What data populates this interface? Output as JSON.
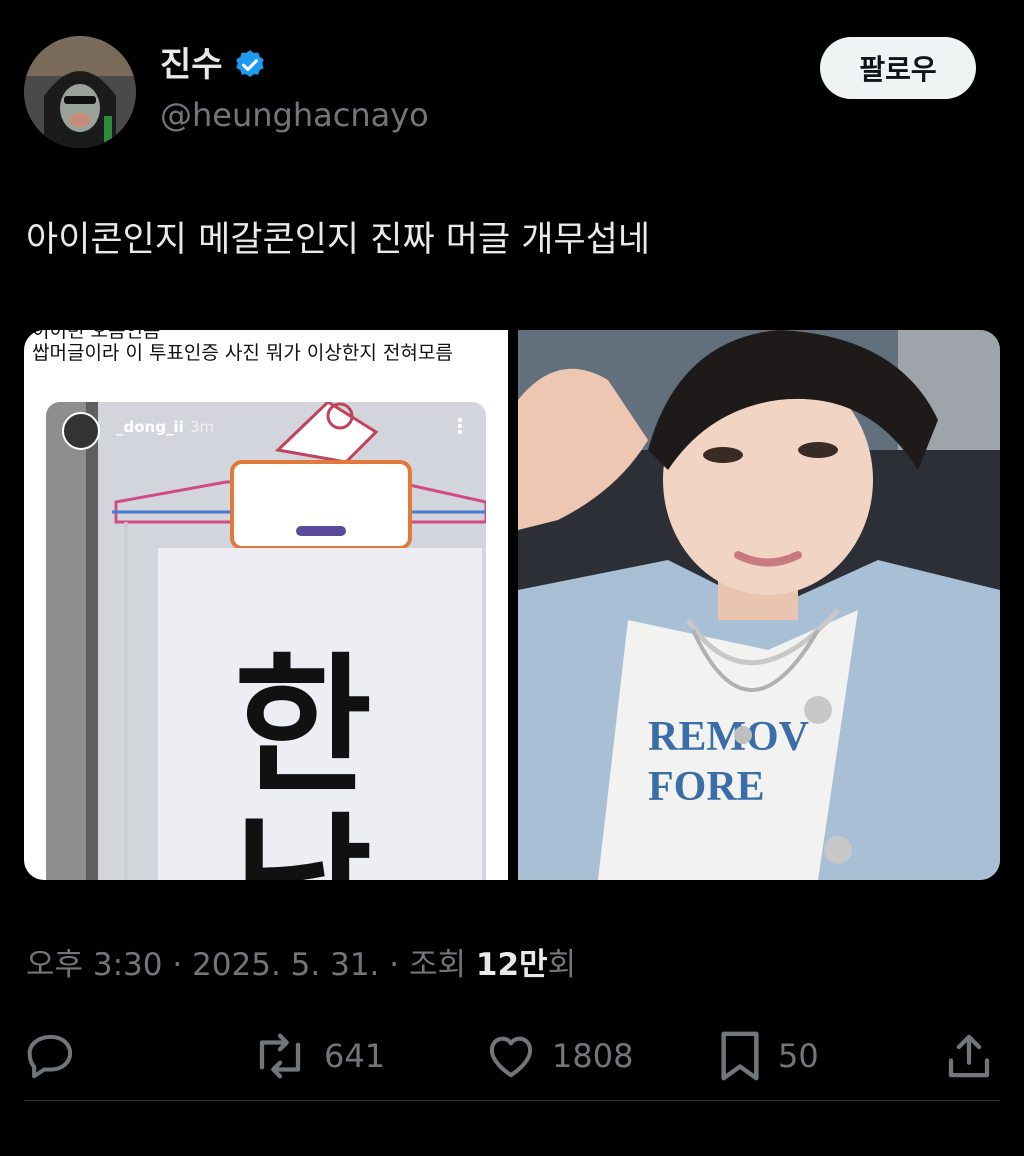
{
  "author": {
    "display_name": "진수",
    "handle": "@heunghacnayo",
    "verified_icon": "verified-badge-icon",
    "verified_color": "#1d9bf0"
  },
  "follow_button": {
    "label": "팔로우"
  },
  "tweet": {
    "text": "아이콘인지 메갈콘인지 진짜 머글 개무섭네"
  },
  "media": {
    "left_image": {
      "caption_top_partial": "이이런 오음인음",
      "caption": "쌉머글이라 이 투표인증 사진 뭐가 이상한지 전혀모름",
      "story_username": "_dong_ii",
      "story_time": "3m",
      "story_menu": "⋮",
      "sign_char_1": "한",
      "sign_char_2": "남"
    },
    "right_image": {
      "description_icon": "selfie-photo"
    }
  },
  "meta": {
    "time": "오후 3:30",
    "separator": " · ",
    "date": "2025. 5. 31.",
    "views_label": "조회",
    "views_count": "12만",
    "views_suffix": "회"
  },
  "actions": {
    "reply": {
      "icon": "reply-icon",
      "count": ""
    },
    "retweet": {
      "icon": "retweet-icon",
      "count": "641"
    },
    "like": {
      "icon": "heart-icon",
      "count": "1808"
    },
    "bookmark": {
      "icon": "bookmark-icon",
      "count": "50"
    },
    "share": {
      "icon": "share-icon"
    }
  },
  "colors": {
    "background": "#000000",
    "text_primary": "#e7e9ea",
    "text_secondary": "#71767b",
    "follow_bg": "#eff3f4"
  }
}
